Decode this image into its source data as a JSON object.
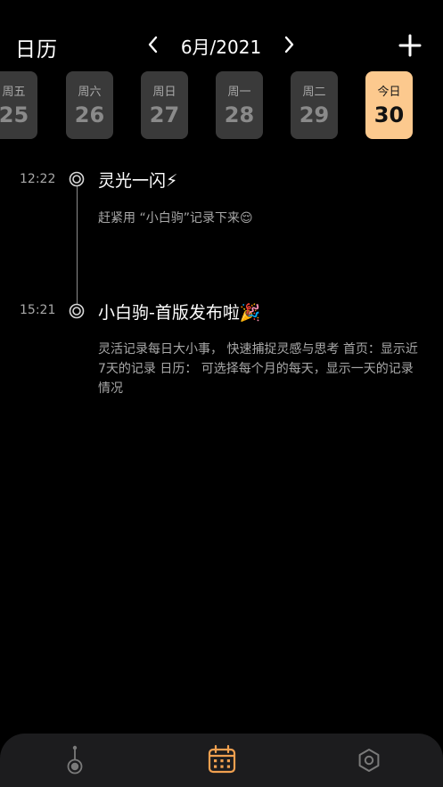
{
  "header": {
    "title": "日历",
    "month_label": "6月/2021"
  },
  "days": [
    {
      "weekday": "周五",
      "day": "25",
      "today": false
    },
    {
      "weekday": "周六",
      "day": "26",
      "today": false
    },
    {
      "weekday": "周日",
      "day": "27",
      "today": false
    },
    {
      "weekday": "周一",
      "day": "28",
      "today": false
    },
    {
      "weekday": "周二",
      "day": "29",
      "today": false
    },
    {
      "weekday": "今日",
      "day": "30",
      "today": true
    }
  ],
  "entries": [
    {
      "time": "12:22",
      "title": "灵光一闪⚡",
      "body": "赶紧用 “小白驹”记录下来😌"
    },
    {
      "time": "15:21",
      "title": "小白驹-首版发布啦🎉",
      "body": "灵活记录每日大小事， 快速捕捉灵感与思考 首页：显示近7天的记录 日历： 可选择每个月的每天，显示一天的记录情况"
    }
  ],
  "tabs": {
    "timeline_icon": "timeline-node-icon",
    "calendar_icon": "calendar-icon",
    "settings_icon": "hexagon-settings-icon",
    "active": "calendar"
  },
  "colors": {
    "background": "#000000",
    "accent": "#fcc98e",
    "tab_active": "#f0a050",
    "card": "#3a3a3a",
    "muted_text": "#a8a8a8"
  }
}
